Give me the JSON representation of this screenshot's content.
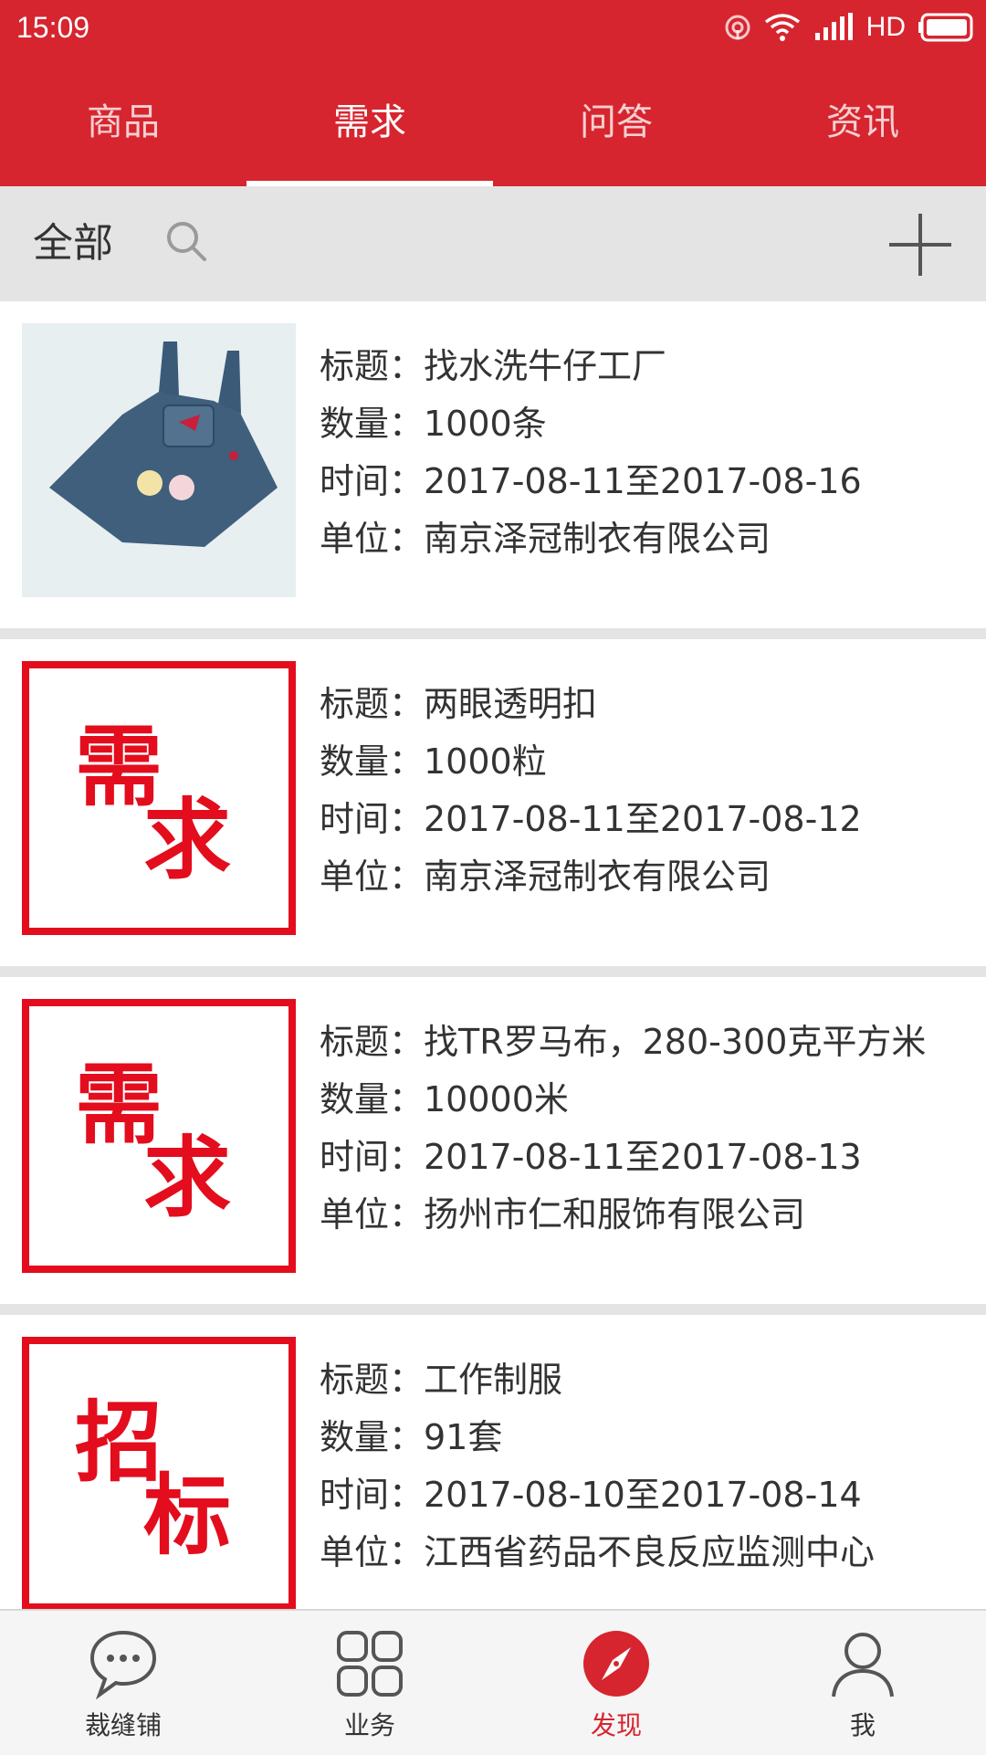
{
  "status_bar": {
    "time": "15:09",
    "network": "HD",
    "icons": [
      "hotspot-icon",
      "wifi-icon",
      "signal-icon",
      "battery-icon"
    ]
  },
  "tabs": [
    {
      "label": "商品",
      "active": false
    },
    {
      "label": "需求",
      "active": true
    },
    {
      "label": "问答",
      "active": false
    },
    {
      "label": "资讯",
      "active": false
    }
  ],
  "filter": {
    "label": "全部",
    "icons": [
      "search-icon",
      "plus-icon"
    ]
  },
  "items": [
    {
      "thumb": {
        "type": "photo",
        "description_icon": "denim-dress-photo"
      },
      "title": "标题：找水洗牛仔工厂",
      "quantity": "数量：1000条",
      "time": "时间：2017-08-11至2017-08-16",
      "company": "单位：南京泽冠制衣有限公司"
    },
    {
      "thumb": {
        "type": "stamp",
        "c1": "需",
        "c2": "求"
      },
      "title": "标题：两眼透明扣",
      "quantity": "数量：1000粒",
      "time": "时间：2017-08-11至2017-08-12",
      "company": "单位：南京泽冠制衣有限公司"
    },
    {
      "thumb": {
        "type": "stamp",
        "c1": "需",
        "c2": "求"
      },
      "title": "标题：找TR罗马布，280-300克平方米",
      "quantity": "数量：10000米",
      "time": "时间：2017-08-11至2017-08-13",
      "company": "单位：扬州市仁和服饰有限公司"
    },
    {
      "thumb": {
        "type": "stamp",
        "c1": "招",
        "c2": "标"
      },
      "title": "标题：工作制服",
      "quantity": "数量：91套",
      "time": "时间：2017-08-10至2017-08-14",
      "company": "单位：江西省药品不良反应监测中心"
    }
  ],
  "bottom_nav": [
    {
      "label": "裁缝铺",
      "icon": "chat-bubble-icon",
      "active": false
    },
    {
      "label": "业务",
      "icon": "grid-icon",
      "active": false
    },
    {
      "label": "发现",
      "icon": "compass-icon",
      "active": true
    },
    {
      "label": "我",
      "icon": "user-icon",
      "active": false
    }
  ],
  "colors": {
    "brand_red": "#d6252f",
    "stamp_red": "#e30d1d",
    "separator": "#e4e4e4",
    "text": "#333333"
  }
}
